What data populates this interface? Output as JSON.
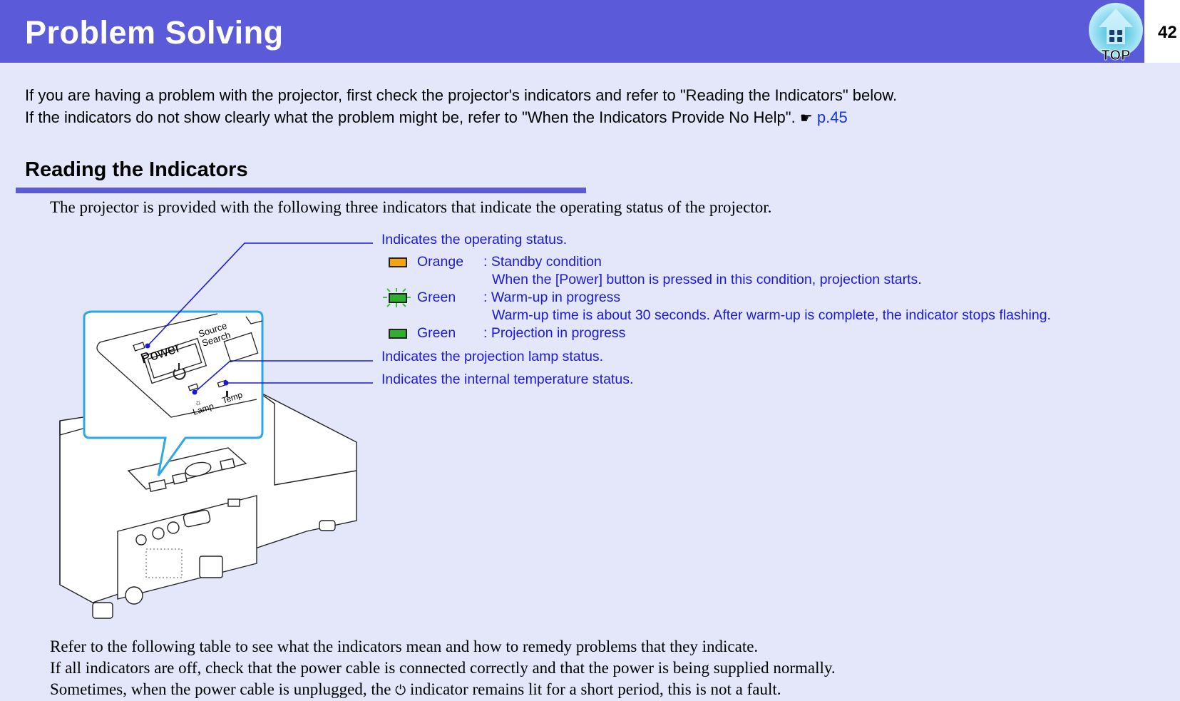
{
  "header": {
    "title": "Problem Solving",
    "top_button_label": "TOP",
    "page_number": "42"
  },
  "intro": {
    "line1": "If you are having a problem with the projector, first check the projector's indicators and refer to \"Reading the Indicators\" below.",
    "line2": "If the indicators do not show clearly what the problem might be, refer to \"When the Indicators Provide No Help\".",
    "ref_icon": "pointing-hand-icon",
    "ref_glyph": "☛",
    "ref_link": "p.45"
  },
  "section": {
    "title": "Reading the Indicators",
    "description": "The projector is provided with the following three indicators that indicate the operating status of the projector."
  },
  "diagram": {
    "power_callout": "Indicates the operating status.",
    "lamp_callout": "Indicates the projection lamp status.",
    "temp_callout": "Indicates the internal temperature status.",
    "panel_labels": {
      "power": "Power",
      "source": "Source",
      "search": "Search",
      "lamp": "Lamp",
      "temp": "Temp"
    },
    "states": [
      {
        "color_name": "Orange",
        "color": "#f5a30f",
        "flashing": false,
        "status": ": Standby condition",
        "detail": "When the [Power] button is pressed in this condition, projection starts."
      },
      {
        "color_name": "Green",
        "color": "#2db02d",
        "flashing": true,
        "status": ": Warm-up in progress",
        "detail": "Warm-up time is about 30 seconds. After warm-up is complete, the indicator stops flashing."
      },
      {
        "color_name": "Green",
        "color": "#2db02d",
        "flashing": false,
        "status": ": Projection in progress",
        "detail": ""
      }
    ]
  },
  "bottom": {
    "line1": "Refer to the following table to see what the indicators mean and how to remedy problems that they indicate.",
    "line2": "If all indicators are off, check that the power cable is connected correctly and that the power is being supplied normally.",
    "line3_pre": "Sometimes, when the power cable is unplugged, the",
    "power_glyph": "⏻",
    "line3_post": "indicator remains lit for a short period, this is not a fault."
  },
  "colors": {
    "header": "#5b5bd9",
    "background": "#e3e7f9",
    "callout": "#1a1ad6",
    "link": "#1033e8"
  }
}
